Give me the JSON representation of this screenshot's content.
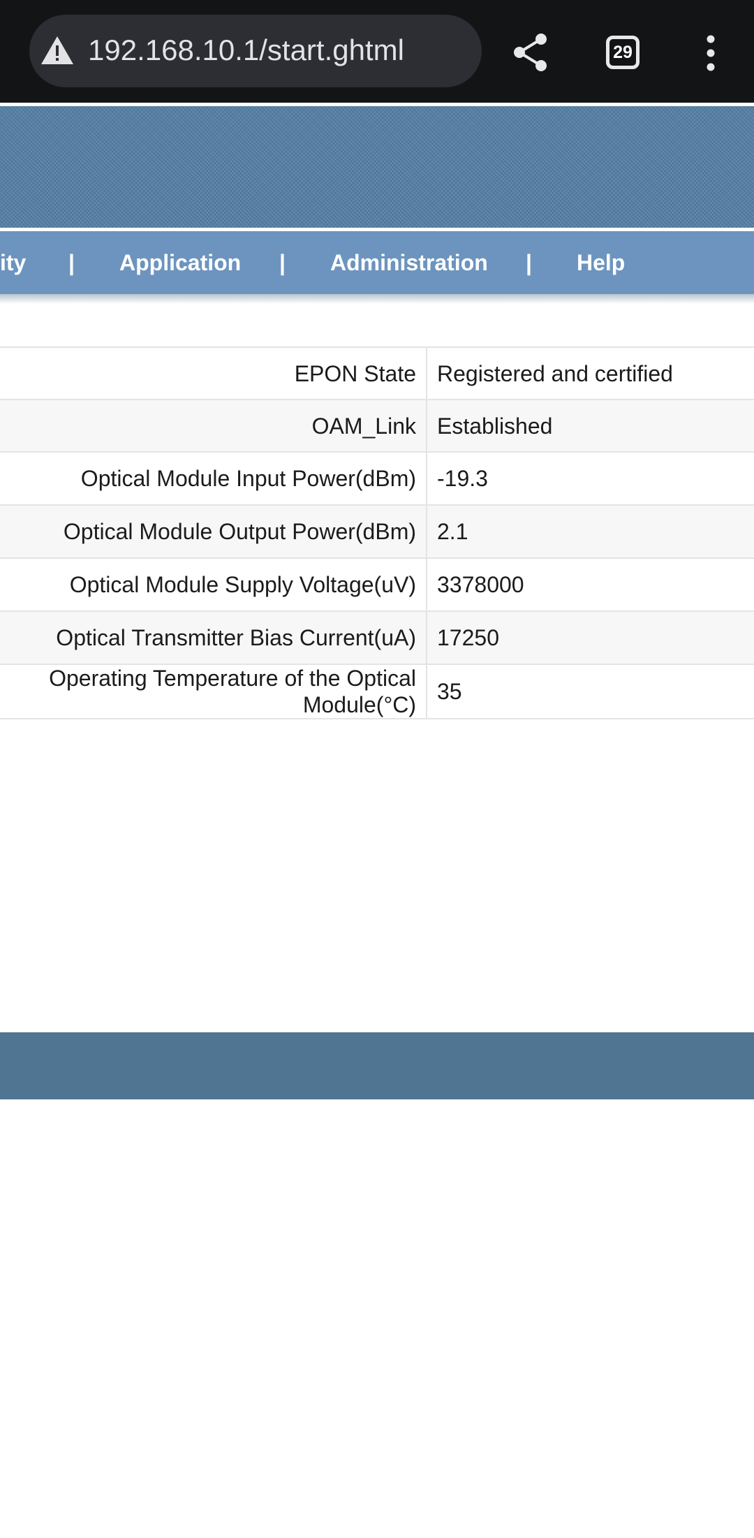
{
  "browser": {
    "url": "192.168.10.1/start.ghtml",
    "tab_count": "29",
    "security_icon": "warning-triangle-icon"
  },
  "nav": {
    "items": [
      {
        "label": "ity"
      },
      {
        "label": "Application"
      },
      {
        "label": "Administration"
      },
      {
        "label": "Help"
      }
    ],
    "divider": "|"
  },
  "table": {
    "rows": [
      {
        "label": "EPON State",
        "value": "Registered and certified"
      },
      {
        "label": "OAM_Link",
        "value": "Established"
      },
      {
        "label": "Optical Module Input Power(dBm)",
        "value": "-19.3"
      },
      {
        "label": "Optical Module Output Power(dBm)",
        "value": "2.1"
      },
      {
        "label": "Optical Module Supply Voltage(uV)",
        "value": "3378000"
      },
      {
        "label": "Optical Transmitter Bias Current(uA)",
        "value": "17250"
      },
      {
        "label": "Operating Temperature of the Optical Module(°C)",
        "value": "35"
      }
    ]
  },
  "colors": {
    "browser_bar": "#131416",
    "banner": "#5580a6",
    "navbar": "#6c94be",
    "footer": "#4f7593"
  }
}
